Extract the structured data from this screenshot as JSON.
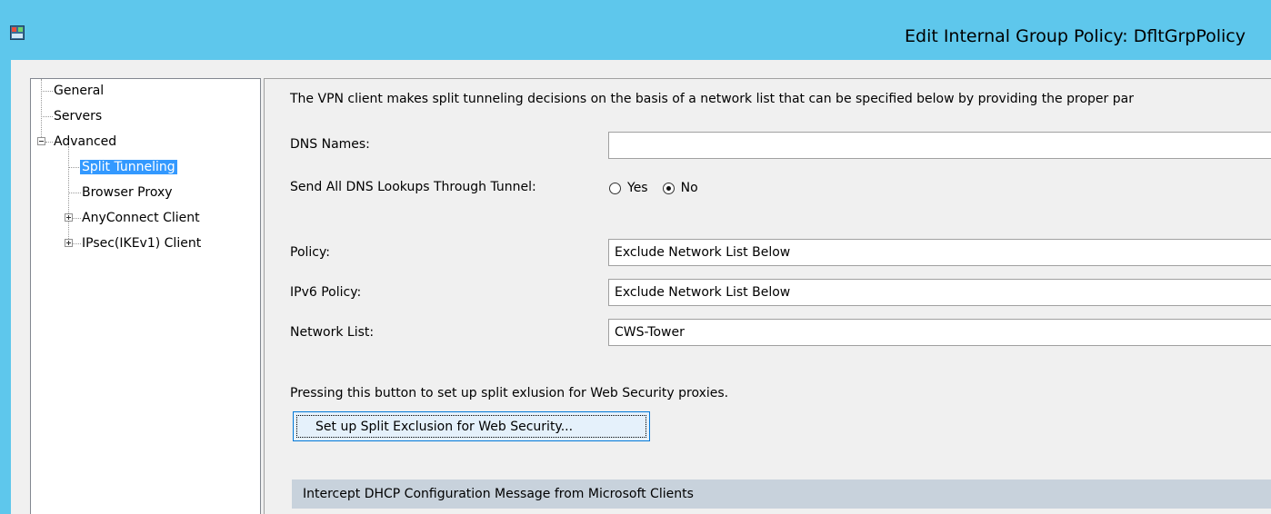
{
  "window": {
    "title": "Edit Internal Group Policy: DfltGrpPolicy",
    "app_icon": "asdm-app-icon"
  },
  "tree": {
    "items": [
      {
        "label": "General"
      },
      {
        "label": "Servers"
      },
      {
        "label": "Advanced"
      },
      {
        "label": "Split Tunneling"
      },
      {
        "label": "Browser Proxy"
      },
      {
        "label": "AnyConnect Client"
      },
      {
        "label": "IPsec(IKEv1) Client"
      }
    ]
  },
  "split_tunneling": {
    "description": "The VPN client makes split tunneling decisions on the basis of a network list that can be specified below by providing the proper par",
    "dns_names": {
      "label": "DNS Names:",
      "value": ""
    },
    "send_all_dns": {
      "label": "Send All DNS Lookups Through Tunnel:",
      "options": [
        {
          "label": "Yes",
          "checked": false
        },
        {
          "label": "No",
          "checked": true
        }
      ]
    },
    "policy": {
      "label": "Policy:",
      "value": "Exclude Network List Below"
    },
    "ipv6_policy": {
      "label": "IPv6 Policy:",
      "value": "Exclude Network List Below"
    },
    "network_list": {
      "label": "Network List:",
      "value": "CWS-Tower"
    },
    "web_security_note": "Pressing this button to set up split exlusion for Web Security proxies.",
    "web_security_button": "Set up Split Exclusion for Web Security...",
    "dhcp_section": "Intercept DHCP Configuration Message from Microsoft Clients"
  },
  "colors": {
    "titlebar": "#5ec7ec",
    "selection": "#3399ff",
    "section_bar": "#c8d2dc"
  }
}
